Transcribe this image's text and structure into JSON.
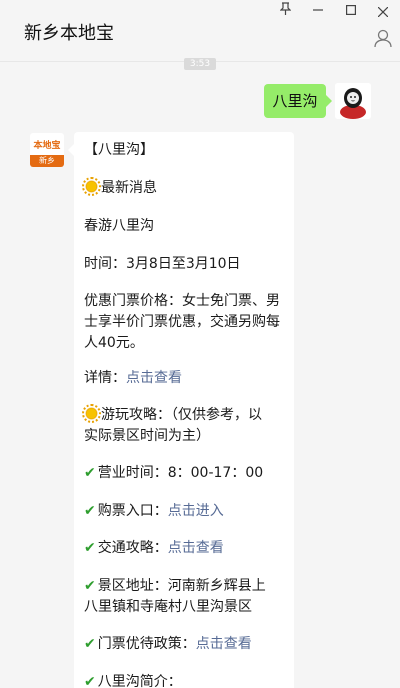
{
  "window": {
    "title": "新乡本地宝",
    "pin_icon": "pin-icon",
    "minimize_icon": "minimize-icon",
    "maximize_icon": "maximize-icon",
    "close_icon": "close-icon",
    "profile_icon": "profile-icon"
  },
  "chat": {
    "timestamp": "3:53",
    "user_message": "八里沟",
    "bot_avatar": {
      "brand": "本地宝",
      "city": "新乡"
    },
    "reply": {
      "title": "【八里沟】",
      "latest_news": "最新消息",
      "event": "春游八里沟",
      "time": "时间：3月8日至3月10日",
      "price_line1": "优惠门票价格：女士免门票、男",
      "price_line2": "士享半价门票优惠，交通另购每",
      "price_line3": "人40元。",
      "details_label": "详情：",
      "details_link": "点击查看",
      "guide_line1": "游玩攻略：（仅供参考，以",
      "guide_line2": "实际景区时间为主）",
      "hours": "营业时间：8：00-17：00",
      "ticket_label": "购票入口：",
      "ticket_link": "点击进入",
      "traffic_label": "交通攻略：",
      "traffic_link": "点击查看",
      "address_line1": "景区地址：河南新乡辉县上",
      "address_line2": "八里镇和寺庵村八里沟景区",
      "policy_label": "门票优待政策：",
      "policy_link": "点击查看",
      "intro": "八里沟简介："
    }
  },
  "colors": {
    "self_bubble": "#95ec69",
    "link": "#576b95",
    "check": "#2f9e2f",
    "brand": "#e46b12"
  }
}
